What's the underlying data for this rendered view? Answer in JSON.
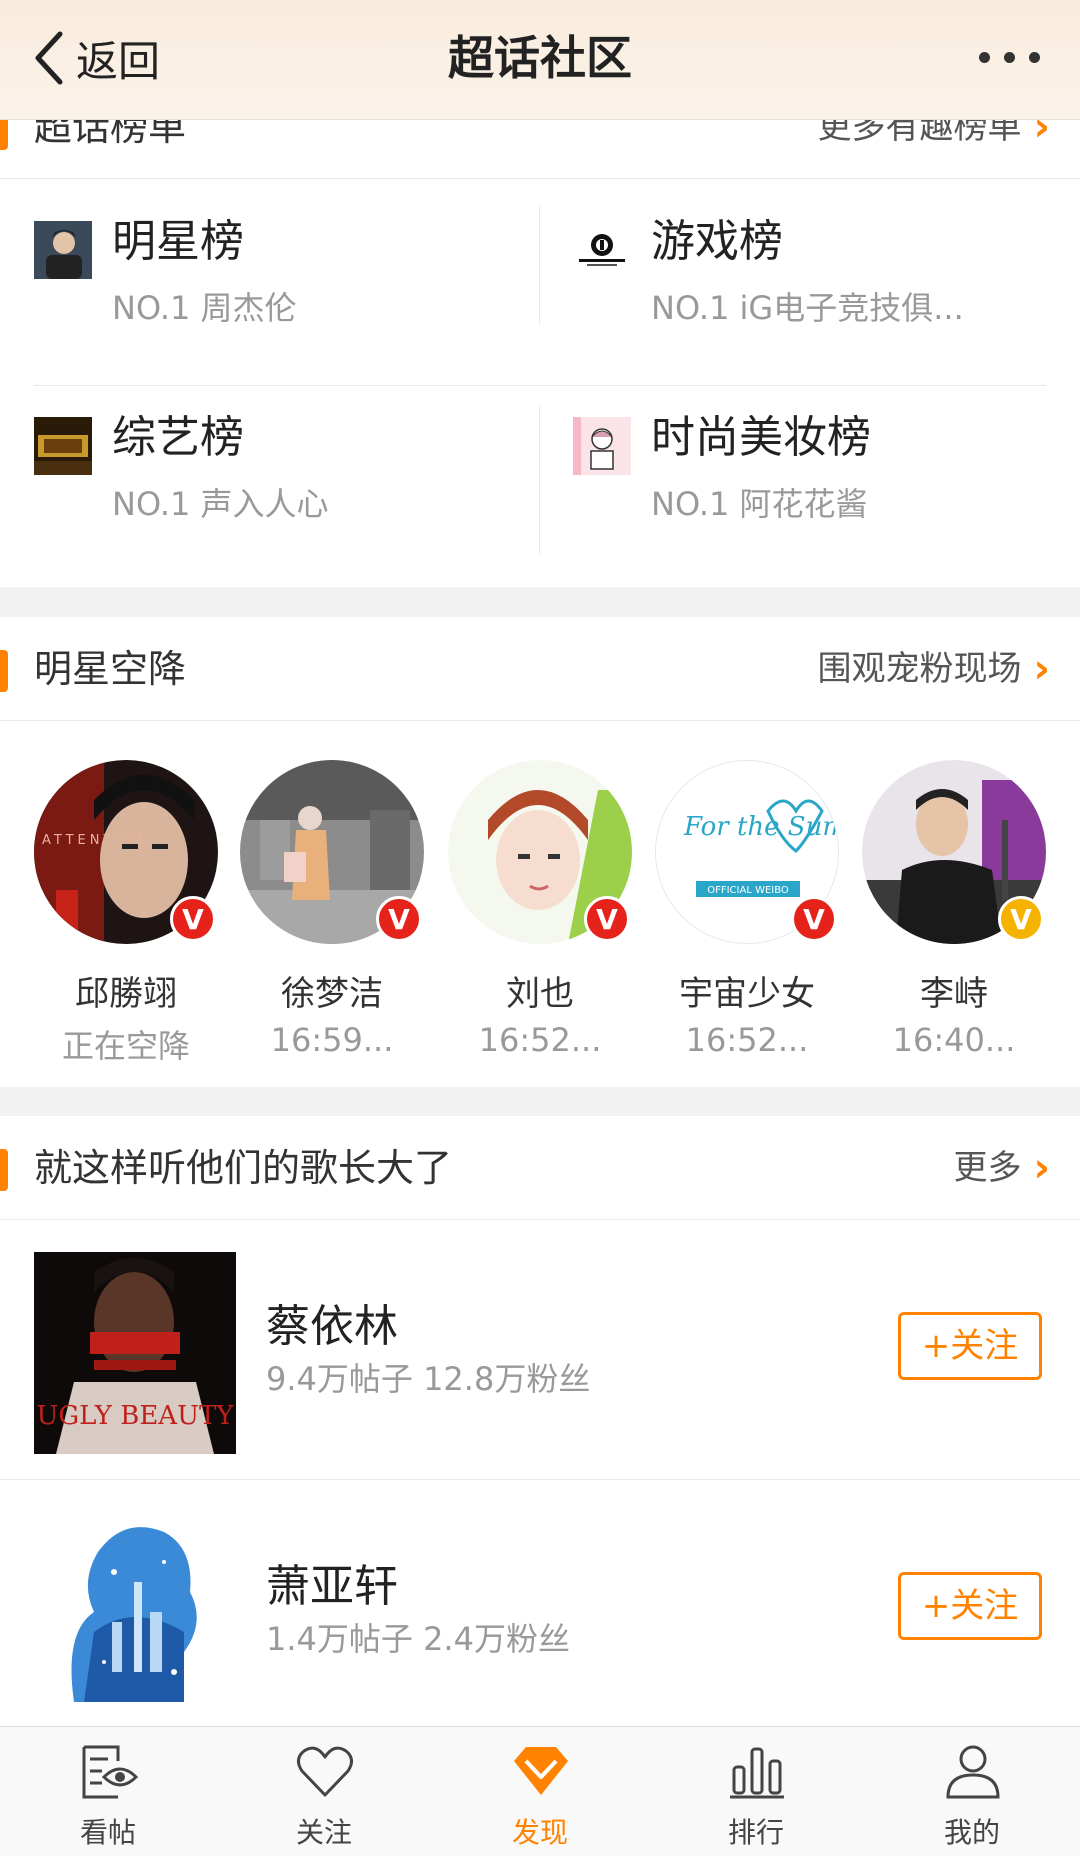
{
  "navbar": {
    "back_label": "返回",
    "title": "超话社区"
  },
  "rank": {
    "title": "超话榜单",
    "link": "更多有趣榜单",
    "items": [
      {
        "name": "明星榜",
        "top": "NO.1 周杰伦",
        "thumb_icon": "jay-chou-photo"
      },
      {
        "name": "游戏榜",
        "top": "NO.1 iG电子竞技俱...",
        "thumb_icon": "ig-gaming-logo"
      },
      {
        "name": "综艺榜",
        "top": "NO.1 声入人心",
        "thumb_icon": "variety-show-poster"
      },
      {
        "name": "时尚美妆榜",
        "top": "NO.1 阿花花酱",
        "thumb_icon": "fashion-illustration"
      }
    ]
  },
  "stars": {
    "title": "明星空降",
    "link": "围观宠粉现场",
    "items": [
      {
        "name": "邱勝翊",
        "time": "正在空降",
        "badge_color": "#e5231a",
        "avatar_text": "ATTENTION"
      },
      {
        "name": "徐梦洁",
        "time": "16:59...",
        "badge_color": "#e5231a"
      },
      {
        "name": "刘也",
        "time": "16:52...",
        "badge_color": "#e5231a"
      },
      {
        "name": "宇宙少女",
        "time": "16:52...",
        "badge_color": "#e5231a",
        "avatar_text_1": "For the Summer",
        "avatar_text_2": "OFFICIAL WEIBO"
      },
      {
        "name": "李峙",
        "time": "16:40...",
        "badge_color": "#f5b300"
      }
    ]
  },
  "music": {
    "title": "就这样听他们的歌长大了",
    "link": "更多",
    "items": [
      {
        "name": "蔡依林",
        "stats": "9.4万帖子  12.8万粉丝",
        "button": "+关注",
        "cover_text": "UGLY BEAUTY"
      },
      {
        "name": "萧亚轩",
        "stats": "1.4万帖子  2.4万粉丝",
        "button": "+关注"
      }
    ]
  },
  "tabs": [
    {
      "label": "看帖",
      "icon": "view-posts-icon"
    },
    {
      "label": "关注",
      "icon": "heart-icon"
    },
    {
      "label": "发现",
      "icon": "diamond-icon",
      "active": true
    },
    {
      "label": "排行",
      "icon": "bar-chart-icon"
    },
    {
      "label": "我的",
      "icon": "user-icon"
    }
  ],
  "colors": {
    "accent": "#ff8200",
    "verified_red": "#e5231a",
    "verified_gold": "#f5b300"
  }
}
